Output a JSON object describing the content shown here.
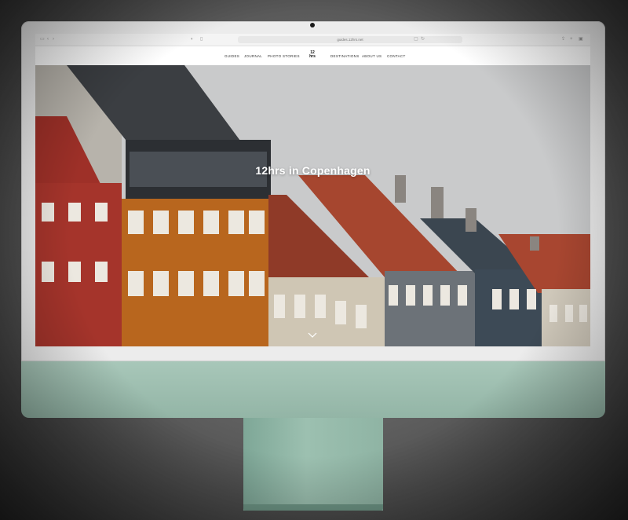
{
  "browser": {
    "url": "guides.12hrs.net"
  },
  "site": {
    "nav_left": [
      "Guides",
      "Journal",
      "Photo Stories"
    ],
    "logo": {
      "line1": "12",
      "line2": "hrs"
    },
    "nav_right": [
      "Destinations",
      "About Us",
      "Contact"
    ]
  },
  "hero": {
    "title": "12hrs in Copenhagen",
    "scroll_icon": "chevron-down-icon"
  },
  "device": {
    "color": "#9cc0b0"
  }
}
